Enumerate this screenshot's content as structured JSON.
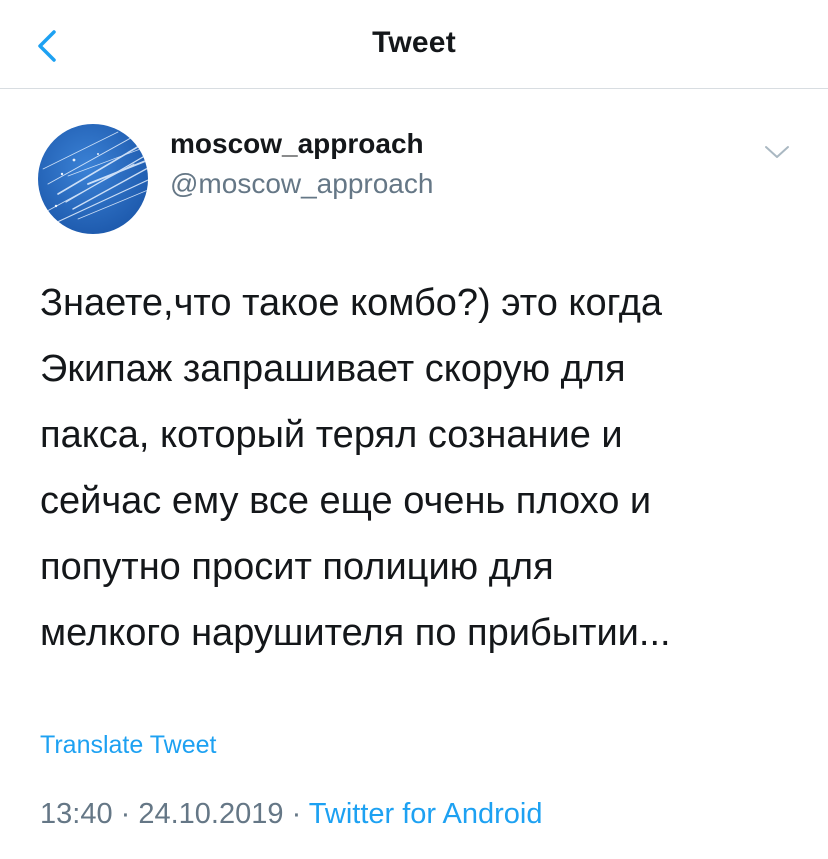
{
  "nav": {
    "title": "Tweet",
    "back_icon": "chevron-left-icon"
  },
  "tweet": {
    "display_name": "moscow_approach",
    "handle": "@moscow_approach",
    "menu_icon": "chevron-down-icon",
    "text": "Знаете,что такое комбо?) это когда\nЭкипаж запрашивает скорую для\nпакса, который терял сознание и\nсейчас ему все еще очень плохо и\nпопутно просит полицию для\nмелкого нарушителя по прибытии...",
    "translate_label": "Translate Tweet",
    "time": "13:40",
    "separator": " · ",
    "date": "24.10.2019",
    "source": "Twitter for Android"
  },
  "colors": {
    "accent": "#1da1f2",
    "text": "#14171a",
    "muted": "#657786",
    "divider": "#d8dde1",
    "avatar_bg": "#1f5fb8"
  }
}
